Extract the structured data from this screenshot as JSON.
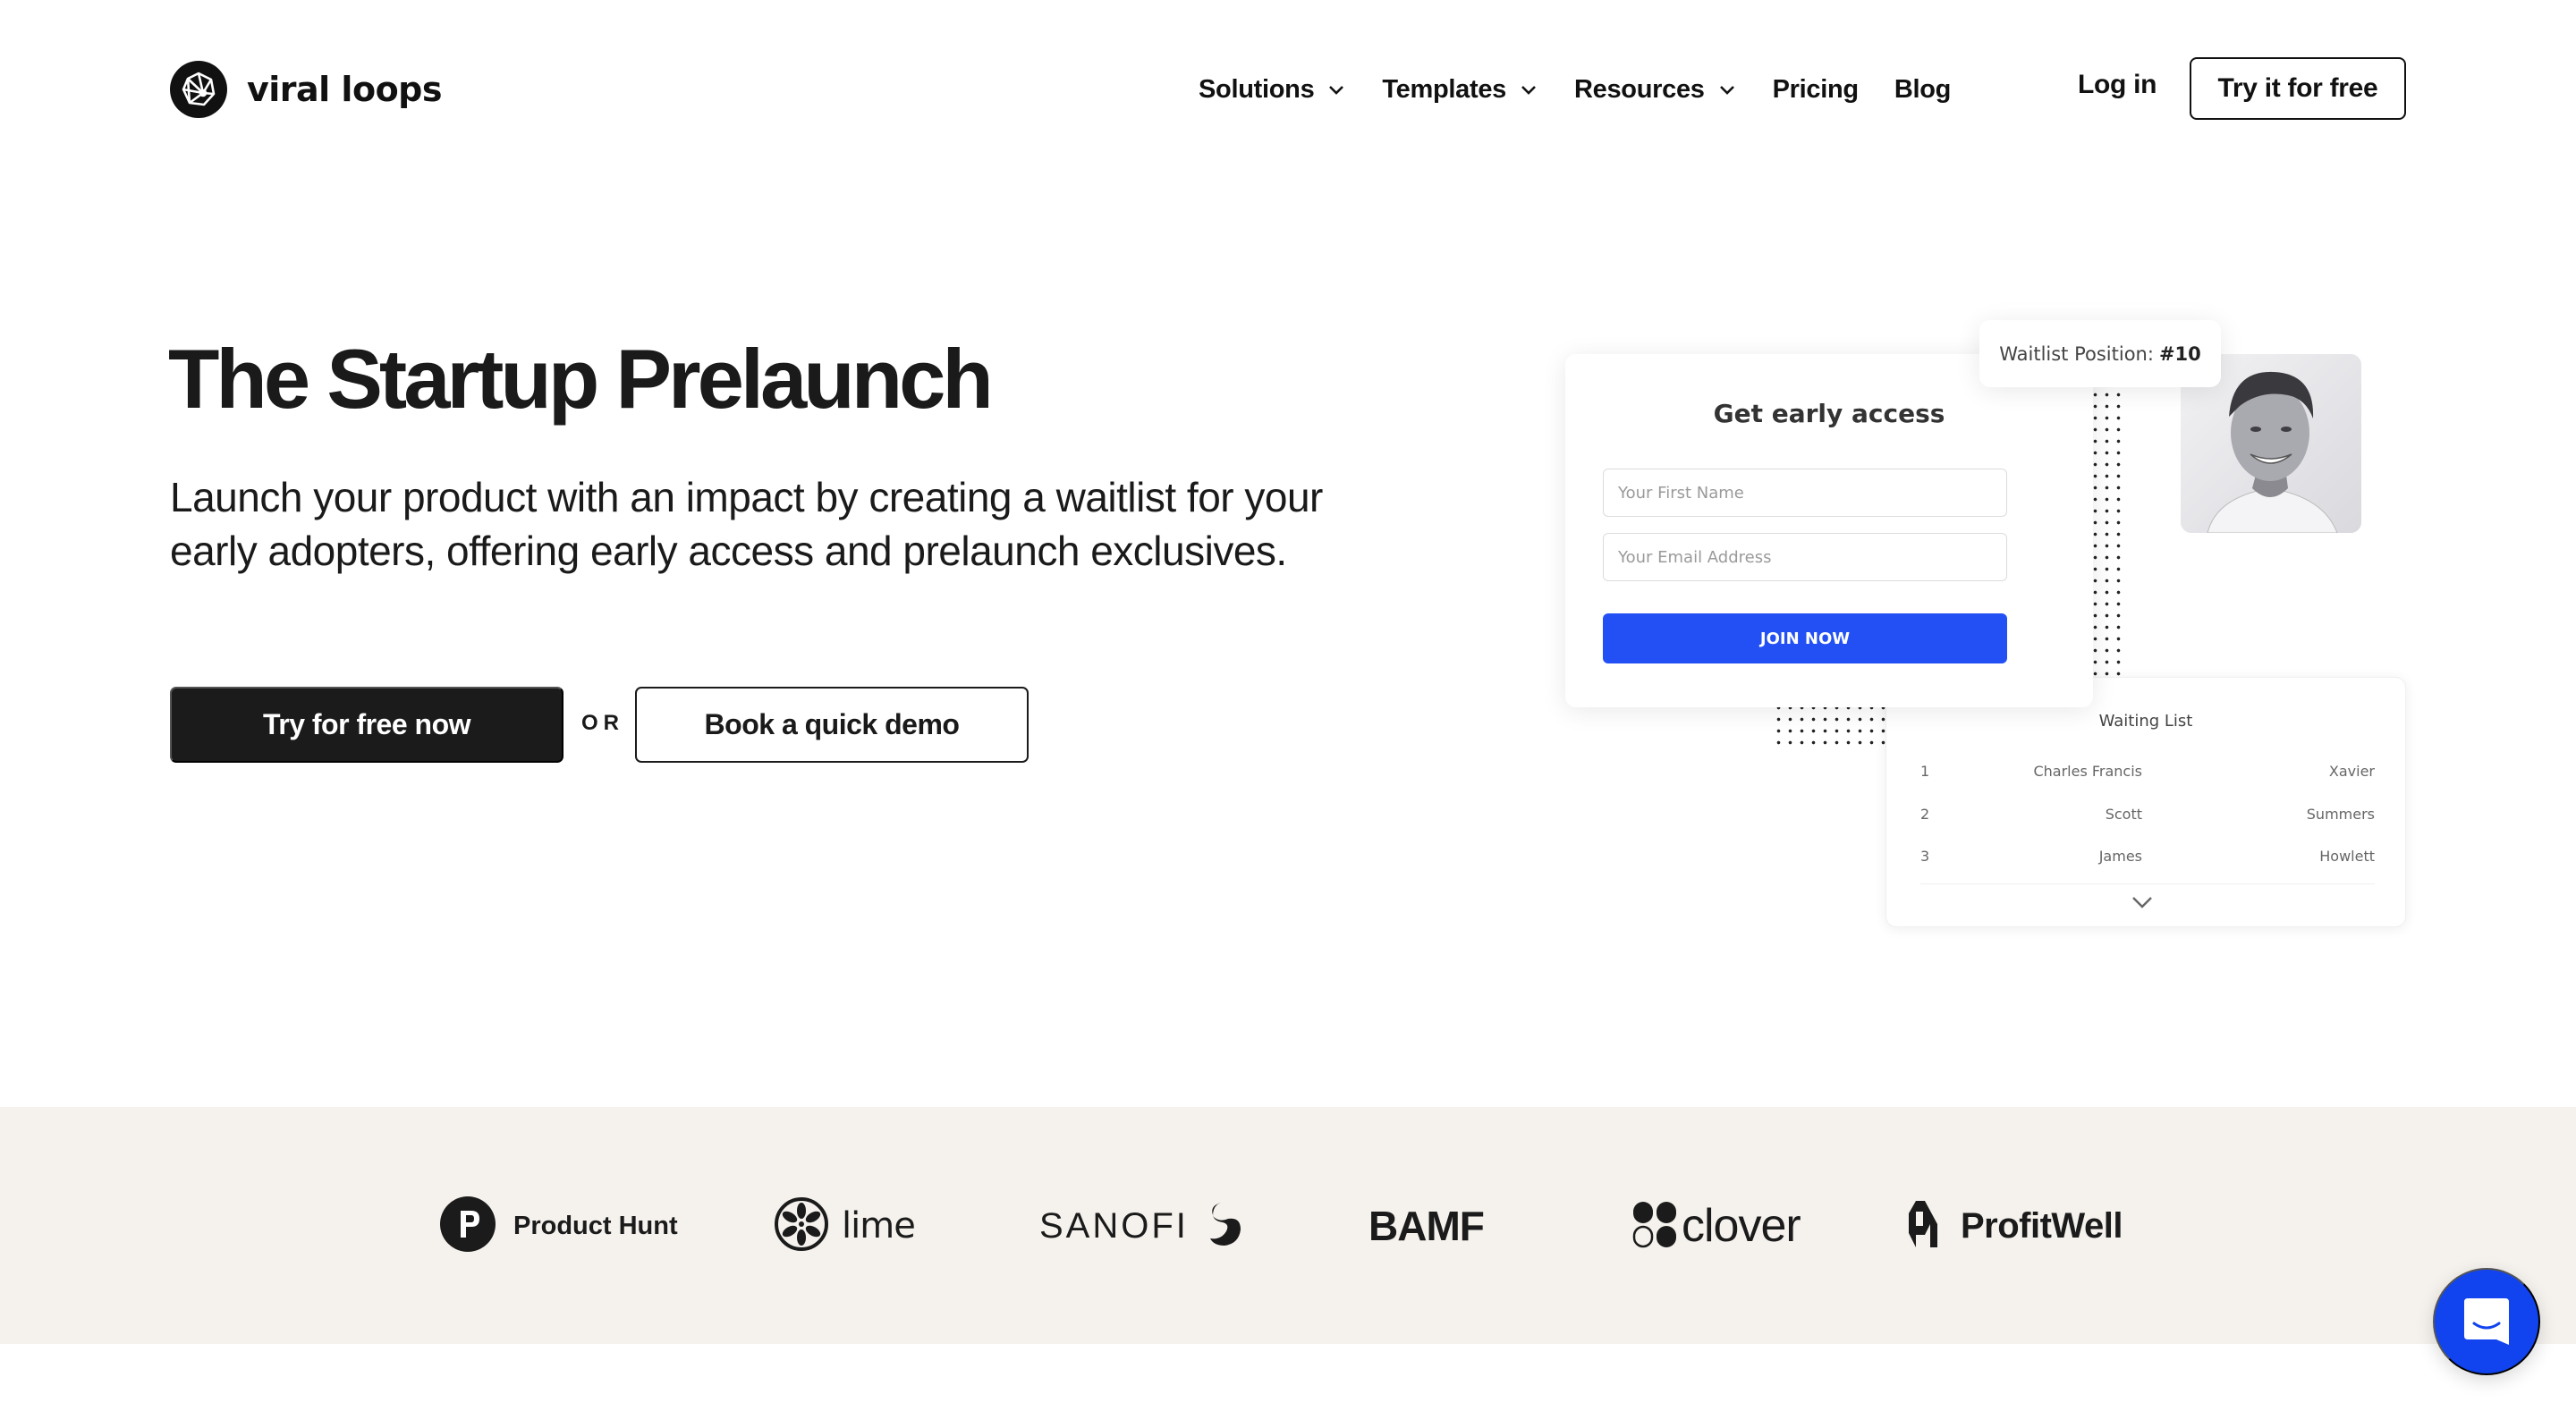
{
  "header": {
    "brand_name": "viral loops",
    "nav": [
      {
        "label": "Solutions",
        "has_dropdown": true
      },
      {
        "label": "Templates",
        "has_dropdown": true
      },
      {
        "label": "Resources",
        "has_dropdown": true
      },
      {
        "label": "Pricing",
        "has_dropdown": false
      },
      {
        "label": "Blog",
        "has_dropdown": false
      }
    ],
    "login_label": "Log in",
    "cta_label": "Try it for free"
  },
  "hero": {
    "title": "The Startup Prelaunch",
    "description": "Launch your product with an impact by creating a waitlist for your early adopters, offering early access and prelaunch exclusives.",
    "primary_cta": "Try for free now",
    "or_text": "OR",
    "secondary_cta": "Book a quick demo"
  },
  "illustration": {
    "form": {
      "title": "Get early access",
      "first_name_placeholder": "Your First Name",
      "email_placeholder": "Your Email Address",
      "submit_label": "JOIN NOW",
      "submit_color": "#2250f4"
    },
    "position_badge": {
      "label": "Waitlist Position:",
      "value": "#10"
    },
    "waiting_list": {
      "title": "Waiting List",
      "rows": [
        {
          "rank": "1",
          "first": "Charles Francis",
          "last": "Xavier"
        },
        {
          "rank": "2",
          "first": "Scott",
          "last": "Summers"
        },
        {
          "rank": "3",
          "first": "James",
          "last": "Howlett"
        }
      ]
    }
  },
  "logos": [
    {
      "name": "Product Hunt",
      "icon": "product-hunt-icon"
    },
    {
      "name": "lime",
      "icon": "lime-icon"
    },
    {
      "name": "SANOFI",
      "icon": "sanofi-icon"
    },
    {
      "name": "BAMF",
      "icon": ""
    },
    {
      "name": "clover",
      "icon": "clover-icon"
    },
    {
      "name": "ProfitWell",
      "icon": "profitwell-icon"
    }
  ],
  "colors": {
    "text": "#1a1a1a",
    "accent_blue": "#2250f4",
    "chat_blue": "#1144ee",
    "band_bg": "#f5f2ee"
  }
}
